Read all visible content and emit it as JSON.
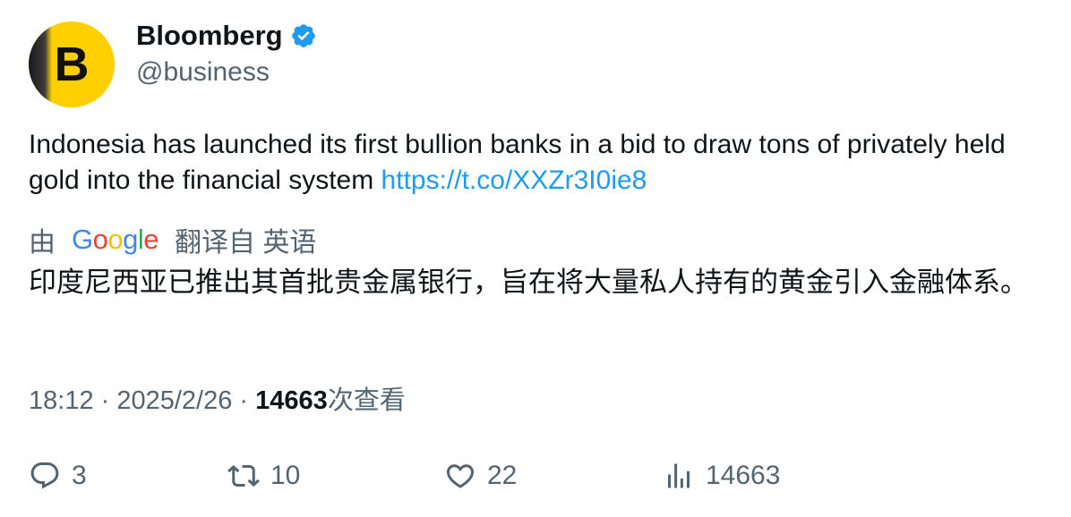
{
  "author": {
    "name": "Bloomberg",
    "handle": "@business",
    "avatar_letter": "B",
    "avatar_color": "#ffcf00",
    "verified_color": "#1d9bf0"
  },
  "tweet": {
    "text": "Indonesia has launched its first bullion banks in a bid to draw tons of privately held gold into the financial system ",
    "link": "https://t.co/XXZr3I0ie8",
    "link_color": "#1d9bf0"
  },
  "translation": {
    "prefix": "由",
    "provider": "Google",
    "suffix": "翻译自 英语",
    "text": "印度尼西亚已推出其首批贵金属银行，旨在将大量私人持有的黄金引入金融体系。"
  },
  "meta": {
    "time": "18:12",
    "separator": " · ",
    "date": "2025/2/26",
    "views": "14663",
    "views_label": "次查看"
  },
  "actions": {
    "replies": "3",
    "retweets": "10",
    "likes": "22",
    "views": "14663"
  }
}
